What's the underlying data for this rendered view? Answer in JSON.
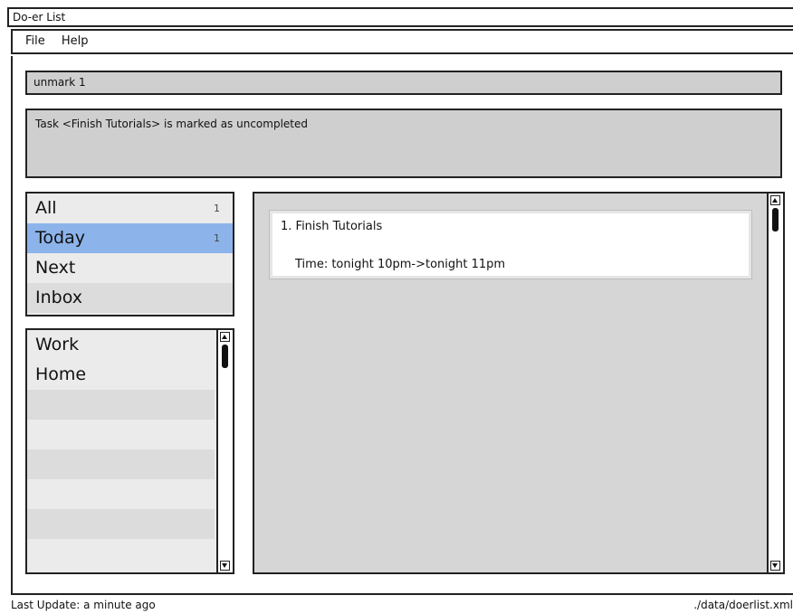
{
  "window": {
    "title": "Do-er List"
  },
  "menu": {
    "items": [
      "File",
      "Help"
    ]
  },
  "command": {
    "value": "unmark 1"
  },
  "feedback": {
    "text": "Task <Finish Tutorials> is marked as uncompleted"
  },
  "categories": [
    {
      "label": "All",
      "count": "1",
      "selected": false
    },
    {
      "label": "Today",
      "count": "1",
      "selected": true
    },
    {
      "label": "Next",
      "count": "",
      "selected": false
    },
    {
      "label": "Inbox",
      "count": "",
      "selected": false
    }
  ],
  "tags": [
    "Work",
    "Home"
  ],
  "tasks": [
    {
      "title": "1. Finish Tutorials",
      "time": "Time: tonight 10pm->tonight 11pm"
    }
  ],
  "status": {
    "last_update": "Last Update: a minute ago",
    "file_path": "./data/doerlist.xml"
  },
  "colors": {
    "selected_row": "#8cb4ea",
    "panel_bg": "#d6d6d6"
  },
  "icons": {
    "scroll_up": "arrow-up-icon",
    "scroll_down": "arrow-down-icon"
  }
}
